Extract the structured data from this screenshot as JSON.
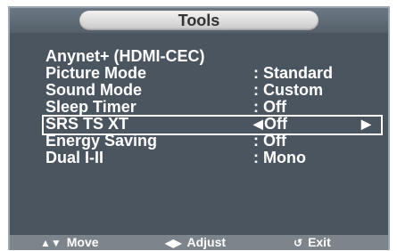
{
  "title": "Tools",
  "menu": {
    "items": [
      {
        "label": "Anynet+ (HDMI-CEC)",
        "value": ""
      },
      {
        "label": "Picture Mode",
        "value": ": Standard"
      },
      {
        "label": "Sound Mode",
        "value": ": Custom"
      },
      {
        "label": "Sleep Timer",
        "value": ": Off"
      },
      {
        "label": "SRS TS XT",
        "value": "Off"
      },
      {
        "label": "Energy Saving",
        "value": ": Off"
      },
      {
        "label": "Dual I-II",
        "value": ": Mono"
      }
    ]
  },
  "footer": {
    "move": "Move",
    "adjust": "Adjust",
    "exit": "Exit"
  }
}
